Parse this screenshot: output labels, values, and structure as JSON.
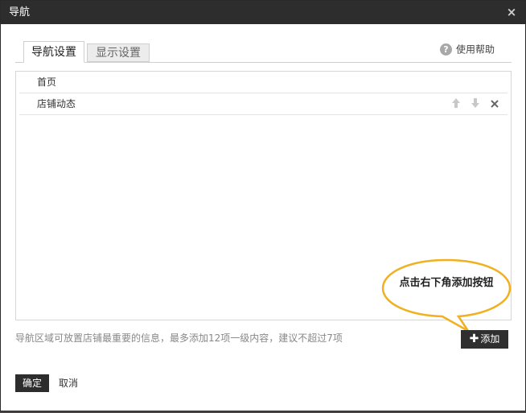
{
  "dialog": {
    "title": "导航",
    "close_glyph": "×"
  },
  "tabs": [
    {
      "label": "导航设置",
      "active": true
    },
    {
      "label": "显示设置",
      "active": false
    }
  ],
  "help": {
    "icon": "question-circle-icon",
    "label": "使用帮助"
  },
  "nav_items": [
    {
      "label": "首页"
    },
    {
      "label": "店铺动态",
      "actions": [
        "arrow-up-icon",
        "arrow-down-icon",
        "delete-icon"
      ]
    }
  ],
  "footer": {
    "note": "导航区域可放置店铺最重要的信息，最多添加12项一级内容，建议不超过7项",
    "add_label": "添加",
    "ok_label": "确定",
    "cancel_label": "取消"
  },
  "callout": {
    "text": "点击右下角添加按钮",
    "fill_color": "#ffffff",
    "border_color": "#f0b020"
  },
  "colors": {
    "titlebar": "#2d2d2d",
    "button_dark": "#2f2f2f"
  }
}
